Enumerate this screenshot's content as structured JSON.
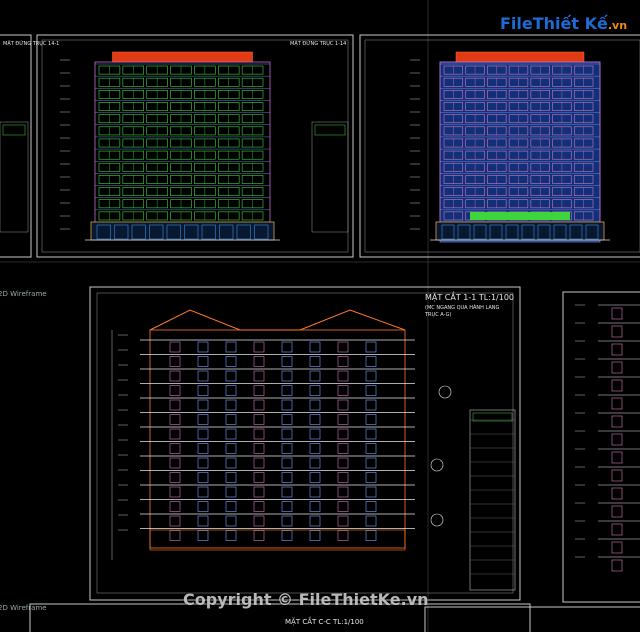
{
  "logo": {
    "file": "File",
    "rest": "Thiết Kế",
    "domain": ".vn"
  },
  "viewports": {
    "view_style_1": "2D Wireframe",
    "view_style_2": "2D Wireframe"
  },
  "sheets": {
    "sheet1_title": "MẶT ĐỨNG TRỤC 1-14",
    "sheet2_title": "MẶT ĐỨNG TRỤC 14-1",
    "sheet3_title": "MẶT CẮT 1-1 TL:1/100",
    "sheet3_subtitle": "(MC NGANG QUA HÀNH LANG",
    "sheet3_subtitle2": "TRỤC A-G)",
    "sheet4_title": "MẶT CẮT C-C TL:1/100"
  },
  "watermark": {
    "text": "Copyright © FileThietKe.vn"
  },
  "colors": {
    "background": "#000000",
    "sheet_border": "#bdbdbd",
    "roof_red": "#e23a12",
    "facade_blue": "#2b5fc9",
    "window_green": "#3cd63c",
    "window_pink": "#d07ab4",
    "logo_blue": "#1e6bd6",
    "logo_orange": "#f08a12"
  }
}
